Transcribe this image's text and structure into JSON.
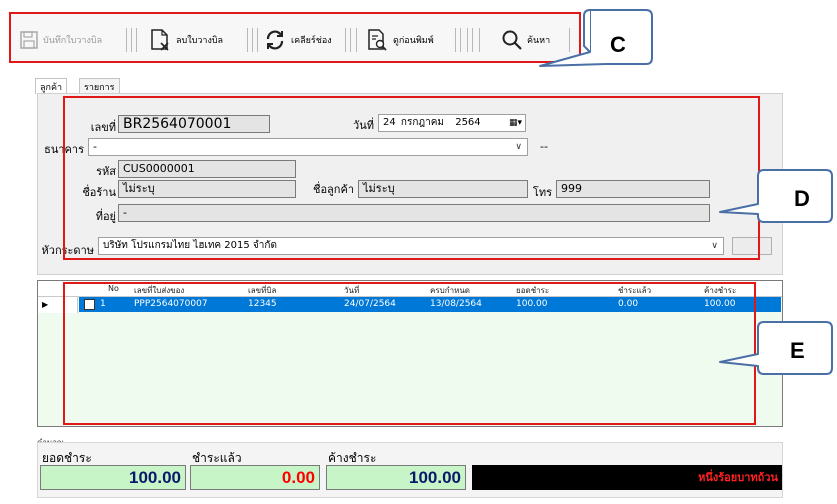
{
  "toolbar": {
    "save_label": "บันทึกใบวางบิล",
    "delete_label": "ลบใบวางบิล",
    "clear_label": "เคลียร์ช่อง",
    "preview_label": "ดูก่อนพิมพ์",
    "search_label": "ค้นหา"
  },
  "callouts": {
    "c": "C",
    "d": "D",
    "e": "E"
  },
  "tabs": {
    "customer": "ลูกค้า",
    "items": "รายการ"
  },
  "form": {
    "doc_no_label": "เลขที่",
    "doc_no": "BR2564070001",
    "date_label": "วันที่",
    "date_day": "24",
    "date_month": "กรกฎาคม",
    "date_year": "2564",
    "bank_label": "ธนาคาร",
    "bank_value": "-",
    "bank_extra": "--",
    "code_label": "รหัส",
    "customer_code": "CUS0000001",
    "shop_label": "ชื่อร้าน",
    "shop_value": "ไม่ระบุ",
    "customer_name_label": "ชื่อลูกค้า",
    "customer_name": "ไม่ระบุ",
    "phone_label": "โทร",
    "phone_value": "999",
    "address_label": "ที่อยู่",
    "address_value": "-",
    "letterhead_label": "หัวกระดาษ",
    "letterhead_value": "บริษัท โปรแกรมไทย ไฮเทค 2015 จำกัด"
  },
  "grid": {
    "columns": [
      "No",
      "เลขที่ใบส่งของ",
      "เลขที่บิล",
      "วันที่",
      "ครบกำหนด",
      "ยอดชำระ",
      "ชำระแล้ว",
      "ค้างชำระ"
    ],
    "rows": [
      {
        "no": "1",
        "delivery_no": "PPP2564070007",
        "bill_no": "12345",
        "date": "24/07/2564",
        "due": "13/08/2564",
        "amount": "100.00",
        "paid": "0.00",
        "outstanding": "100.00",
        "checked": false
      }
    ]
  },
  "totals": {
    "caption": "คำนวณ",
    "amount_label": "ยอดชำระ",
    "amount": "100.00",
    "paid_label": "ชำระแล้ว",
    "paid": "0.00",
    "outstanding_label": "ค้างชำระ",
    "outstanding": "100.00",
    "text_amount": "หนึ่งร้อยบาทถ้วน"
  },
  "colors": {
    "annotation": "#e01818",
    "callout_fill": "#ffffff",
    "callout_border": "#4a6fa5",
    "selection": "#0078d7",
    "grid_bg": "#effbef",
    "total_green": "#c8f5c8",
    "paid_red": "#ff0000",
    "text_amount_bg": "#000000",
    "text_amount_fg": "#ff2020"
  }
}
